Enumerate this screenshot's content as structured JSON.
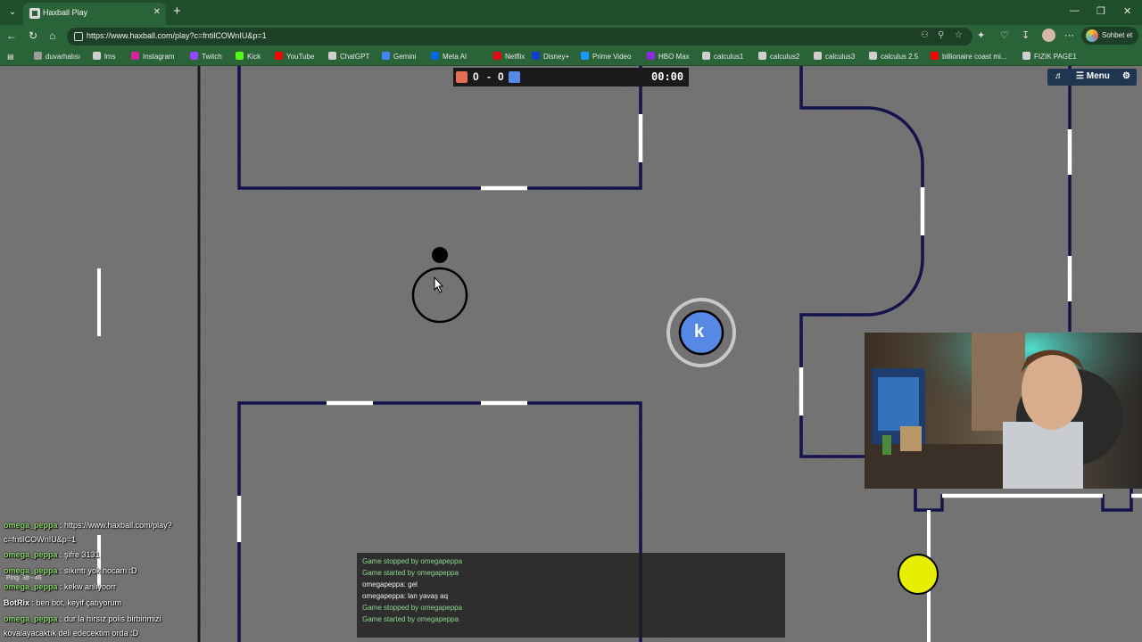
{
  "browser": {
    "tab_title": "Haxball Play",
    "url": "https://www.haxball.com/play?c=fntilCOWnIU&p=1",
    "copilot_label": "Sohbet et",
    "bookmarks": [
      "duvarhalısı",
      "lms",
      "Instagram",
      "Twitch",
      "Kick",
      "YouTube",
      "ChatGPT",
      "Gemini",
      "Meta AI",
      "Netflix",
      "Disney+",
      "Prime Video",
      "HBO Max",
      "calculus1",
      "calculus2",
      "calculus3",
      "calculus 2.5",
      "billionaire coast mi...",
      "FIZIK PAGE1"
    ],
    "bookmark_colors": [
      "#9e9e9e",
      "#cfcfcf",
      "#d6249f",
      "#9146ff",
      "#53fc18",
      "#ff0000",
      "#cfcfcf",
      "#4285f4",
      "#0668e1",
      "#e50914",
      "#113ccf",
      "#1a98ff",
      "#8a2be2",
      "#cfcfcf",
      "#cfcfcf",
      "#cfcfcf",
      "#cfcfcf",
      "#ff0000",
      "#cfcfcf"
    ]
  },
  "game": {
    "score_red": "0",
    "score_sep": "-",
    "score_blue": "0",
    "timer": "00:00",
    "menu_label": "Menu",
    "player_avatar": "k",
    "colors": {
      "red_team": "#e56e56",
      "blue_team": "#5689e5",
      "field": "#707070",
      "walls": "#14134a",
      "ball_yellow": "#e6ef00"
    }
  },
  "chatlog": [
    {
      "text": "Game stopped by omegapeppa",
      "type": "sys"
    },
    {
      "text": "Game started by omegapeppa",
      "type": "sys"
    },
    {
      "text": "omegapeppa: gel",
      "type": "msg"
    },
    {
      "text": "omegapeppa: lan yavaş aq",
      "type": "msg"
    },
    {
      "text": "Game stopped by omegapeppa",
      "type": "sys"
    },
    {
      "text": "Game started by omegapeppa",
      "type": "sys"
    }
  ],
  "twitch_chat": [
    {
      "user": "omega_peppa",
      "msg": " : https://www.haxball.com/play?"
    },
    {
      "user": "",
      "msg": "c=fntilCOWnIU&p=1"
    },
    {
      "user": "omega_peppa",
      "msg": " : şifre 3131"
    },
    {
      "user": "omega_peppa",
      "msg": " : sıkıntı yok hocam :D"
    },
    {
      "user": "omega_peppa",
      "msg": " : kekw anlıyoorr"
    },
    {
      "user": "BotRix",
      "msg": " : ben bot, keyif çatıyorum"
    },
    {
      "user": "omega_peppa",
      "msg": " : dur la hırsız polis birbirimizi"
    },
    {
      "user": "",
      "msg": "kovalayacaktık deli edecektim orda :D"
    }
  ],
  "ping": "Ping: 38 - 46"
}
